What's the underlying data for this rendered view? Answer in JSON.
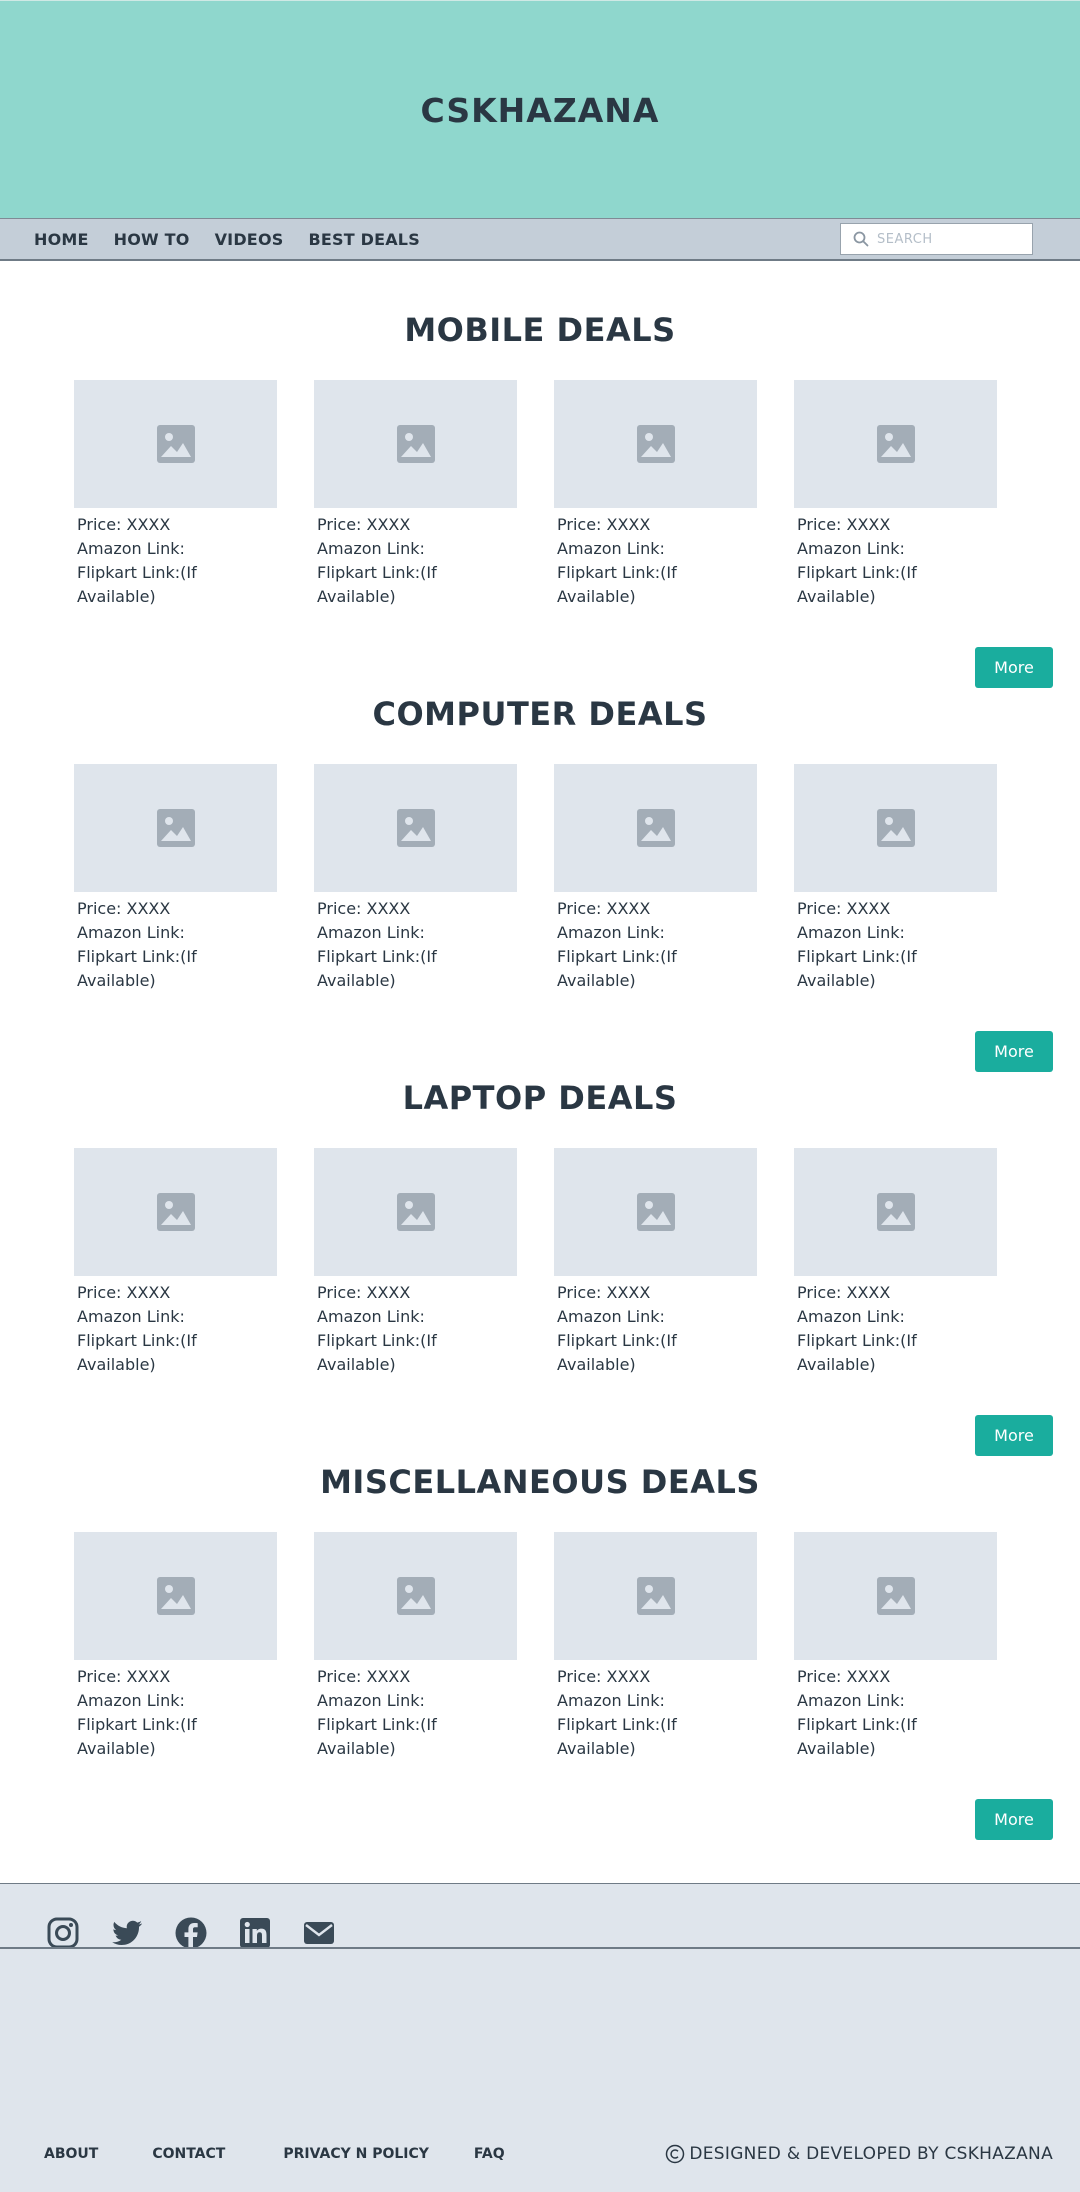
{
  "site": {
    "brand": "CSKHAZANA"
  },
  "nav": {
    "items": [
      "HOME",
      "HOW TO",
      "VIDEOS",
      "BEST DEALS"
    ],
    "search_placeholder": "SEARCH"
  },
  "card": {
    "price_label": "Price: XXXX",
    "amazon_label": "Amazon Link:",
    "flipkart_label": "Flipkart Link:(If Available)"
  },
  "sections": [
    {
      "title": "MOBILE DEALS",
      "more_label": "More"
    },
    {
      "title": "COMPUTER DEALS",
      "more_label": "More"
    },
    {
      "title": "LAPTOP DEALS",
      "more_label": "More"
    },
    {
      "title": "MISCELLANEOUS DEALS",
      "more_label": "More"
    }
  ],
  "footer": {
    "socials": [
      "instagram-icon",
      "twitter-icon",
      "facebook-icon",
      "linkedin-icon",
      "email-icon"
    ],
    "links": [
      "ABOUT",
      "CONTACT",
      "PRIVACY N POLICY",
      "FAQ"
    ],
    "copyright": "DESIGNED & DEVELOPED BY CSKHAZANA"
  },
  "colors": {
    "hero_bg": "#8fd7cd",
    "nav_bg": "#c4ced8",
    "accent": "#1aad9e",
    "text": "#2a3743",
    "placeholder_bg": "#dfe5ec",
    "footer_bg": "#dfe5ec"
  }
}
